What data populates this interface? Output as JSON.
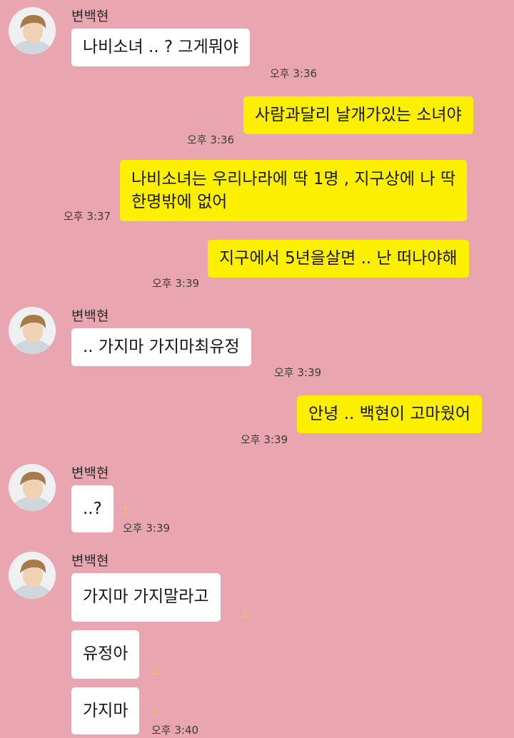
{
  "sender_name": "변백현",
  "messages": [
    {
      "text": "나비소녀 .. ? 그게뭐야",
      "time": "오후 3:36"
    },
    {
      "text": "사람과달리 날개가있는 소녀야",
      "time": "오후 3:36"
    },
    {
      "line1": "나비소녀는 우리나라에 딱 1명 , 지구상에 나 딱",
      "line2": "한명밖에 없어",
      "time": "오후 3:37"
    },
    {
      "text": "지구에서 5년을살면 .. 난 떠나야해",
      "time": "오후 3:39"
    },
    {
      "text": ".. 가지마 가지마최유정",
      "time": "오후 3:39"
    },
    {
      "text": "안녕 .. 백현이 고마웠어",
      "time": "오후 3:39"
    },
    {
      "text": "..?",
      "unread": "1",
      "time": "오후 3:39"
    },
    {
      "text": "가지마 가지말라고",
      "unread": "1"
    },
    {
      "text": "유정아",
      "unread": "1"
    },
    {
      "text": "가지마",
      "unread": "1",
      "time": "오후 3:40"
    }
  ],
  "icons": {
    "avatar": "profile-photo"
  },
  "colors": {
    "background": "#e9a6b1",
    "incoming_bubble": "#ffffff",
    "outgoing_bubble": "#fcf000",
    "unread_count": "#e7c44a"
  }
}
